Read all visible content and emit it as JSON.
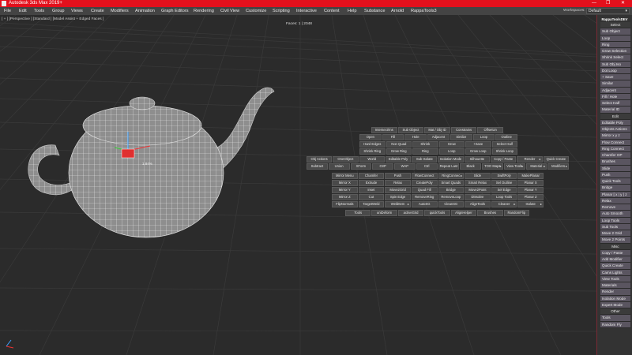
{
  "window": {
    "title": "Autodesk 3ds Max 2019+",
    "min": "—",
    "restore": "❐",
    "close": "✕"
  },
  "menu": [
    "File",
    "Edit",
    "Tools",
    "Group",
    "Views",
    "Create",
    "Modifiers",
    "Animation",
    "Graph Editors",
    "Rendering",
    "Civil View",
    "Customize",
    "Scripting",
    "Interactive",
    "Content",
    "Help",
    "Substance",
    "Arnold",
    "RappaTools3"
  ],
  "workspace": {
    "label": "Workspaces:",
    "value": "Default",
    "arrow": "▾"
  },
  "viewport": {
    "label": "[ + ] [Perspective ] [Standard ] [Model Assist + Edged Faces ]",
    "faces": "Faces: 1 | 2048",
    "gizmo_readout": "1.84%"
  },
  "quad_rows": [
    [
      {
        "l": "Intersect/Ins"
      },
      {
        "l": "Sub Object"
      },
      {
        "l": "Mat / Obj ID"
      },
      {
        "l": "Constrains"
      },
      {
        "l": "OffsetUn"
      }
    ],
    [
      {
        "l": "Open"
      },
      {
        "l": "Fill"
      },
      {
        "l": "Hole"
      },
      {
        "l": "Adjacent"
      },
      {
        "l": "Similar"
      },
      {
        "l": "Loop"
      },
      {
        "l": "Outline"
      }
    ],
    [
      {
        "l": "Hard Edges"
      },
      {
        "l": "Non Quad"
      },
      {
        "l": "Shrink"
      },
      {
        "l": "Grow"
      },
      {
        "l": "+Save"
      },
      {
        "l": "Select Half"
      }
    ],
    [
      {
        "l": "Shrink Ring"
      },
      {
        "l": "Grow Ring"
      },
      {
        "l": "Ring"
      },
      {
        "l": "Loop"
      },
      {
        "l": "Grow Loop"
      },
      {
        "l": "Shrink Loop"
      }
    ],
    [
      {
        "l": "Obj Actions"
      },
      {
        "l": "OneObject"
      },
      {
        "l": "World"
      },
      {
        "l": "Editable Poly"
      },
      {
        "l": "Sub Isolate"
      },
      {
        "l": "Isolation Mode"
      },
      {
        "l": "Silhouette"
      },
      {
        "l": "Copy / Paste"
      },
      {
        "l": "Render",
        "a": "▸"
      },
      {
        "l": "Quick Create"
      }
    ],
    [
      {
        "l": "Subtract"
      },
      {
        "l": "Union"
      },
      {
        "l": "XForm"
      },
      {
        "l": "CtrP"
      },
      {
        "l": "WAP"
      },
      {
        "l": "Ctrl"
      },
      {
        "l": "Repeat Last"
      },
      {
        "l": "Black"
      },
      {
        "l": "TOO Maps",
        "a": "▸"
      },
      {
        "l": "View Tools",
        "a": "▸"
      },
      {
        "l": "Material",
        "a": "▸"
      },
      {
        "l": "Modifiers",
        "a": "▸"
      }
    ],
    [
      {
        "l": "Mirror Menu"
      },
      {
        "l": "Chamfer"
      },
      {
        "l": "Push"
      },
      {
        "l": "FlowConnect"
      },
      {
        "l": "RingConnec",
        "a": "▸"
      },
      {
        "l": "Slide"
      },
      {
        "l": "SwiftPoly"
      },
      {
        "l": "MakePlanar"
      }
    ],
    [
      {
        "l": "Mirror X"
      },
      {
        "l": "Extrude"
      },
      {
        "l": "Relax"
      },
      {
        "l": "CreatePoly"
      },
      {
        "l": "Smart Quads"
      },
      {
        "l": "Smart Relax"
      },
      {
        "l": "Sel Outline"
      },
      {
        "l": "Planar X"
      }
    ],
    [
      {
        "l": "Mirror Y"
      },
      {
        "l": "Inset"
      },
      {
        "l": "Move2Grid"
      },
      {
        "l": "Quad Fill"
      },
      {
        "l": "Bridge"
      },
      {
        "l": "Move2Point"
      },
      {
        "l": "Sel Edge"
      },
      {
        "l": "Planar Y"
      }
    ],
    [
      {
        "l": "Mirror Z"
      },
      {
        "l": "Cut"
      },
      {
        "l": "Spin Edge"
      },
      {
        "l": "RemoveRing"
      },
      {
        "l": "RemoveLoop"
      },
      {
        "l": "Dissolve"
      },
      {
        "l": "Loop Tools"
      },
      {
        "l": "Planar Z"
      }
    ],
    [
      {
        "l": "FlipNormals"
      },
      {
        "l": "TargetWeld"
      },
      {
        "l": "WeldItem",
        "a": "▸"
      },
      {
        "l": "AutoSG"
      },
      {
        "l": "CleanSG"
      },
      {
        "l": "AlignTools"
      },
      {
        "l": "Cleaner",
        "a": "▸"
      },
      {
        "l": "Isolate",
        "a": "▸"
      }
    ],
    [
      {
        "l": "Tools"
      },
      {
        "l": "uniDeform"
      },
      {
        "l": "activeGrid"
      },
      {
        "l": "quickTools"
      },
      {
        "l": "AlignHelper"
      },
      {
        "l": "Brushes"
      },
      {
        "l": "RandomFlip"
      }
    ]
  ],
  "panel": {
    "title": "RappaToolsDEV",
    "items": [
      {
        "l": "Select",
        "h": 1
      },
      {
        "l": "Sub Object"
      },
      {
        "l": "Loop"
      },
      {
        "l": "Ring"
      },
      {
        "l": "Grow Selection"
      },
      {
        "l": "Shrink Select"
      },
      {
        "l": "Sub Obj Iso"
      },
      {
        "l": "Dot Loop"
      },
      {
        "l": "+ Save"
      },
      {
        "l": "Similar"
      },
      {
        "l": "Adjacent"
      },
      {
        "l": "Fill / Hole"
      },
      {
        "l": "Select Half"
      },
      {
        "l": "Material ID"
      },
      {
        "l": "Edit",
        "h": 1
      },
      {
        "l": "Editable Poly"
      },
      {
        "l": "Objects Actions"
      },
      {
        "l": "Mirror   x  y  z"
      },
      {
        "l": "Flow Connect"
      },
      {
        "l": "Ring Connect"
      },
      {
        "l": "Chamfer OP"
      },
      {
        "l": "Brushes"
      },
      {
        "l": "Slide"
      },
      {
        "l": "Push"
      },
      {
        "l": "Quick Tools"
      },
      {
        "l": "Bridge"
      },
      {
        "l": "Planar [ x | y | z"
      },
      {
        "l": "Relax"
      },
      {
        "l": "Remove"
      },
      {
        "l": "Auto Smooth"
      },
      {
        "l": "Loop Tools"
      },
      {
        "l": "Sub Tools"
      },
      {
        "l": "Move 2 Grid"
      },
      {
        "l": "Move 2 Points"
      },
      {
        "l": "Misc",
        "h": 1
      },
      {
        "l": "Copy / Paste"
      },
      {
        "l": "Add Modifier"
      },
      {
        "l": "Quick Create"
      },
      {
        "l": "Cams Lights"
      },
      {
        "l": "View Tools"
      },
      {
        "l": "Materials"
      },
      {
        "l": "Render"
      },
      {
        "l": "Isolation Mode"
      },
      {
        "l": "Expert Mode"
      },
      {
        "l": "Other",
        "h": 1
      },
      {
        "l": "Tools"
      },
      {
        "l": "Random Fly"
      }
    ]
  }
}
